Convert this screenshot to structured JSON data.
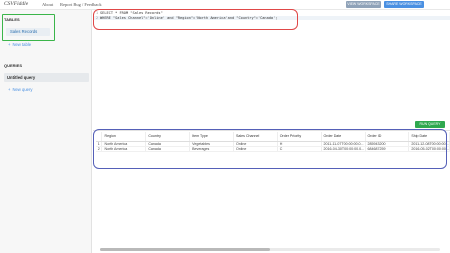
{
  "topbar": {
    "brand": "CSVFiddle",
    "nav": [
      "About",
      "Report Bug / Feedback"
    ],
    "view_workspace_label": "VIEW WORKSPACE",
    "share_workspace_label": "SHARE WORKSPACE"
  },
  "sidebar": {
    "tables_title": "TABLES",
    "tables": [
      "Sales Records"
    ],
    "new_table_label": "New table",
    "queries_title": "QUERIES",
    "queries": [
      "Untitled query"
    ],
    "new_query_label": "New query"
  },
  "editor": {
    "lines": [
      {
        "num": "1",
        "text": "SELECT * FROM \"Sales Records\""
      },
      {
        "num": "2",
        "text": "WHERE \"Sales Channel\"='Online' and \"Region\"='North America'and \"Country\"='Canada';"
      }
    ]
  },
  "run_query_label": "RUN QUERY",
  "results": {
    "columns": [
      "Region",
      "Country",
      "Item Type",
      "Sales Channel",
      "Order Priority",
      "Order Date",
      "Order ID",
      "Ship Date"
    ],
    "rows": [
      [
        "1",
        "North America",
        "Canada",
        "Vegetables",
        "Online",
        "H",
        "2011-11-07T00:00:00.0...",
        "285943200",
        "2011-12-08T00:00:00..."
      ],
      [
        "2",
        "North America",
        "Canada",
        "Beverages",
        "Online",
        "C",
        "2016-04-30T00:00:00.0...",
        "684687259",
        "2016-05-02T00:00:00..."
      ]
    ]
  }
}
